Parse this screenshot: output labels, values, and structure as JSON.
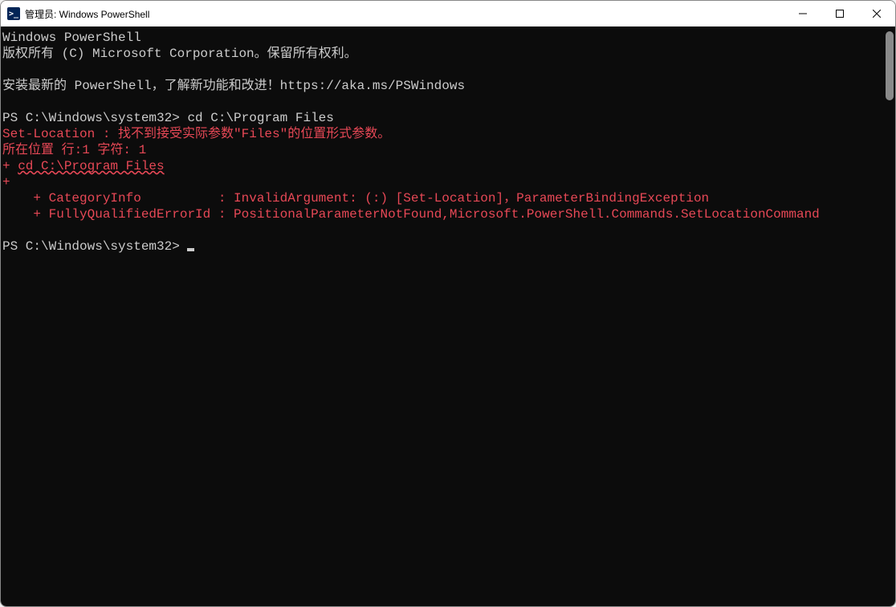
{
  "window": {
    "title": "管理员: Windows PowerShell",
    "icon_label": ">_"
  },
  "terminal": {
    "banner1": "Windows PowerShell",
    "banner2": "版权所有 (C) Microsoft Corporation。保留所有权利。",
    "hint": "安装最新的 PowerShell，了解新功能和改进！https://aka.ms/PSWindows",
    "prompt1": "PS C:\\Windows\\system32> ",
    "cmd1": "cd C:\\Program Files",
    "err1": "Set-Location : 找不到接受实际参数\"Files\"的位置形式参数。",
    "err2": "所在位置 行:1 字符: 1",
    "err3a": "+ ",
    "err3b": "cd C:\\Program Files",
    "err4": "+ ",
    "err5": "    + CategoryInfo          : InvalidArgument: (:) [Set-Location]，ParameterBindingException",
    "err6": "    + FullyQualifiedErrorId : PositionalParameterNotFound,Microsoft.PowerShell.Commands.SetLocationCommand",
    "prompt2": "PS C:\\Windows\\system32> "
  }
}
